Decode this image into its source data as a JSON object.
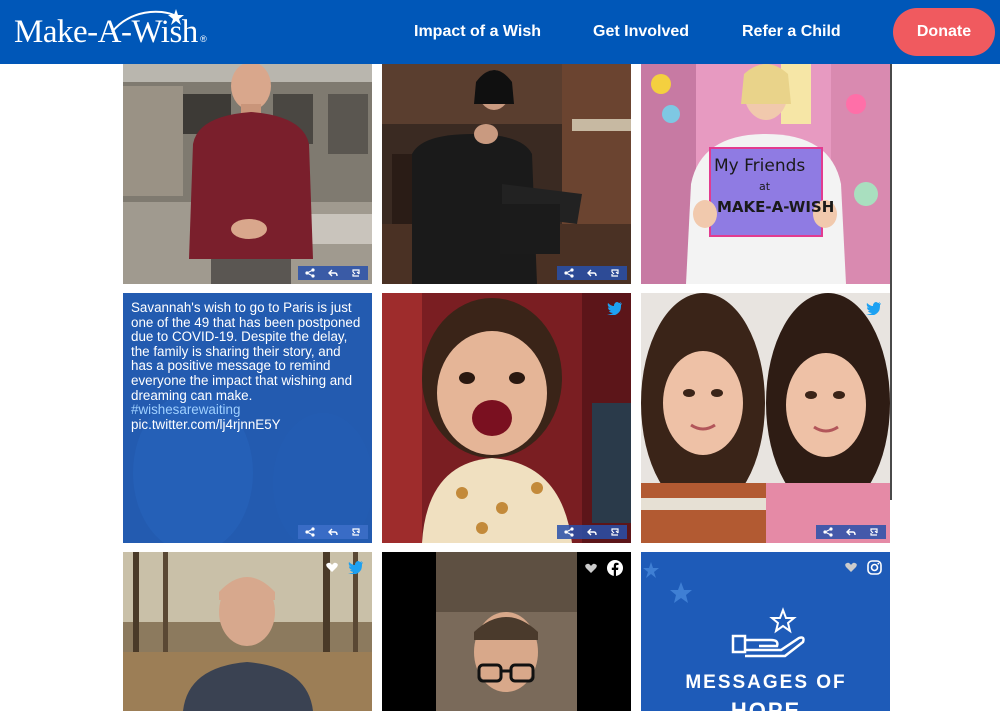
{
  "header": {
    "logo_text": "Make-A-Wish",
    "logo_reg": "®",
    "nav": [
      "Impact of a Wish",
      "Get Involved",
      "Refer a Child"
    ],
    "donate_label": "Donate"
  },
  "colors": {
    "brand_blue": "#0057b8",
    "donate_red": "#f05a5f",
    "tweet_overlay": "#1e5bb8"
  },
  "feed": {
    "tweet": {
      "text": "Savannah's wish to go to Paris is just one of the 49 that has been postponed due to COVID-19. Despite the delay, the family is sharing their story, and has a positive message to remind everyone the impact that wishing and dreaming can make.",
      "hashtag": "#wishesarewaiting",
      "link": "pic.twitter.com/lj4rjnnE5Y"
    },
    "sign": {
      "line1": "My Friends",
      "line2": "at",
      "line3": "MAKE-A-WISH"
    },
    "messages": {
      "title": "MESSAGES OF",
      "title_partial": "HOPE"
    },
    "icons": {
      "share": "share-icon",
      "reply": "reply-icon",
      "retweet": "retweet-icon",
      "twitter": "twitter-icon",
      "facebook": "facebook-icon",
      "instagram": "instagram-icon",
      "heart": "heart-icon"
    }
  }
}
